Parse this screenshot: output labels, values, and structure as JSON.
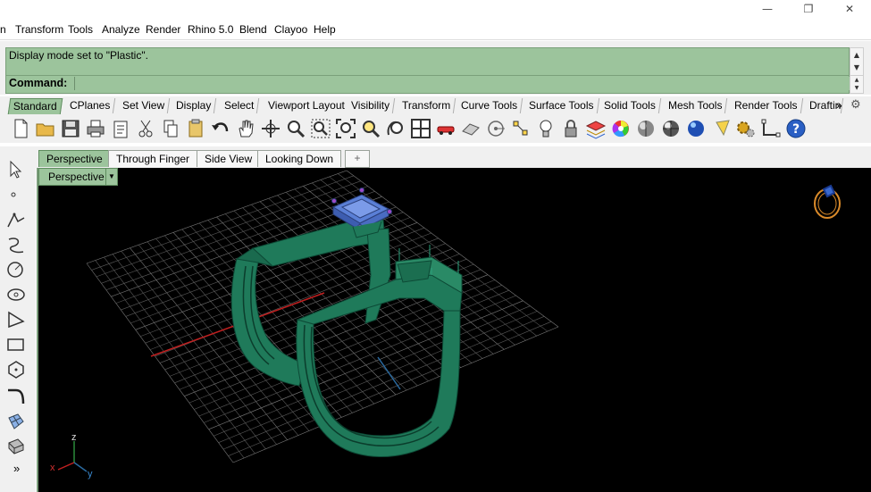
{
  "window": {
    "minimize": "—",
    "restore": "❐",
    "close": "✕"
  },
  "menu": [
    "n",
    "Transform",
    "Tools",
    "Analyze",
    "Render",
    "Rhino 5.0",
    "Blend",
    "Clayoo",
    "Help"
  ],
  "command_history": "Display mode set to \"Plastic\".",
  "command_prompt": "Command:",
  "toolbar_tabs": [
    "Standard",
    "CPlanes",
    "Set View",
    "Display",
    "Select",
    "Viewport Layout",
    "Visibility",
    "Transform",
    "Curve Tools",
    "Surface Tools",
    "Solid Tools",
    "Mesh Tools",
    "Render Tools",
    "Draftin"
  ],
  "toolbar_more": "»",
  "viewport_tabs": [
    "Perspective",
    "Through Finger",
    "Side View",
    "Looking Down"
  ],
  "viewport_add": "+",
  "viewport_label": "Perspective",
  "axes": {
    "x": "x",
    "y": "y",
    "z": "z"
  },
  "left_more": "»",
  "colors": {
    "panel_green": "#9cc49c",
    "model_green": "#1f7a5a",
    "gem_blue": "#5a7fd6"
  }
}
